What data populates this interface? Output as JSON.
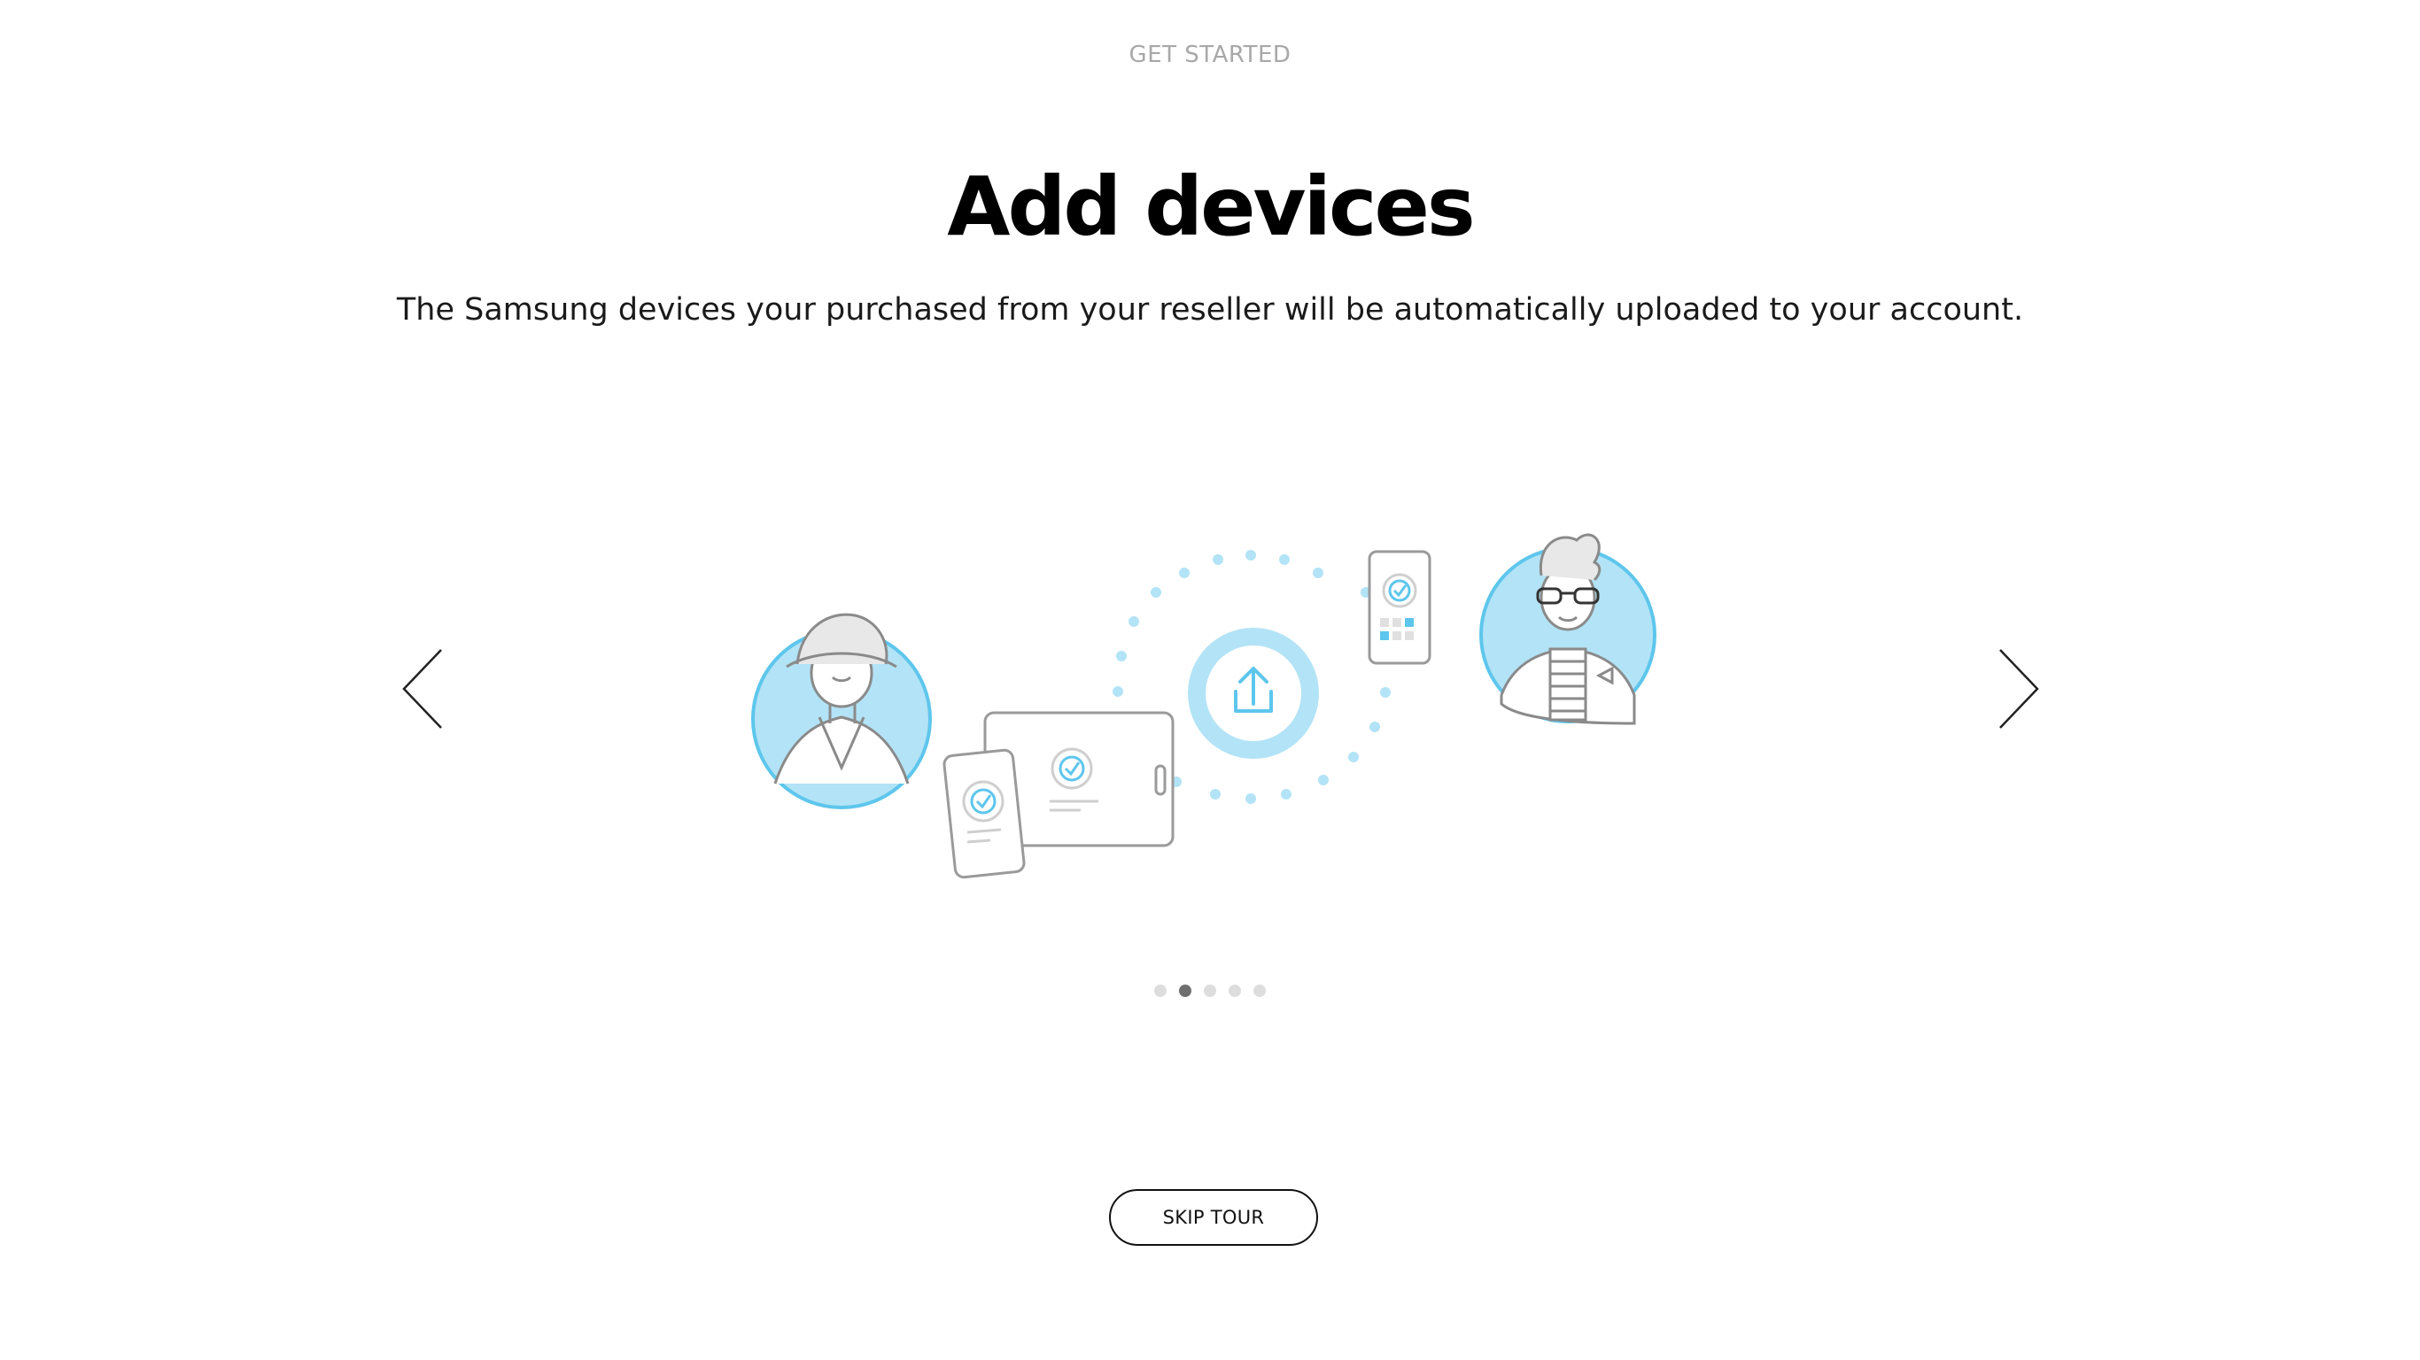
{
  "header": {
    "eyebrow": "GET STARTED",
    "title": "Add devices",
    "subtitle": "The Samsung devices your purchased from your reseller will be automatically uploaded to your account."
  },
  "carousel": {
    "prev_icon": "chevron-left-icon",
    "next_icon": "chevron-right-icon",
    "total_slides": 5,
    "active_slide": 2
  },
  "actions": {
    "skip_label": "SKIP TOUR"
  },
  "colors": {
    "accent_light": "#b3e3f6",
    "accent": "#5ec6ec",
    "line": "#9a9a9a"
  }
}
